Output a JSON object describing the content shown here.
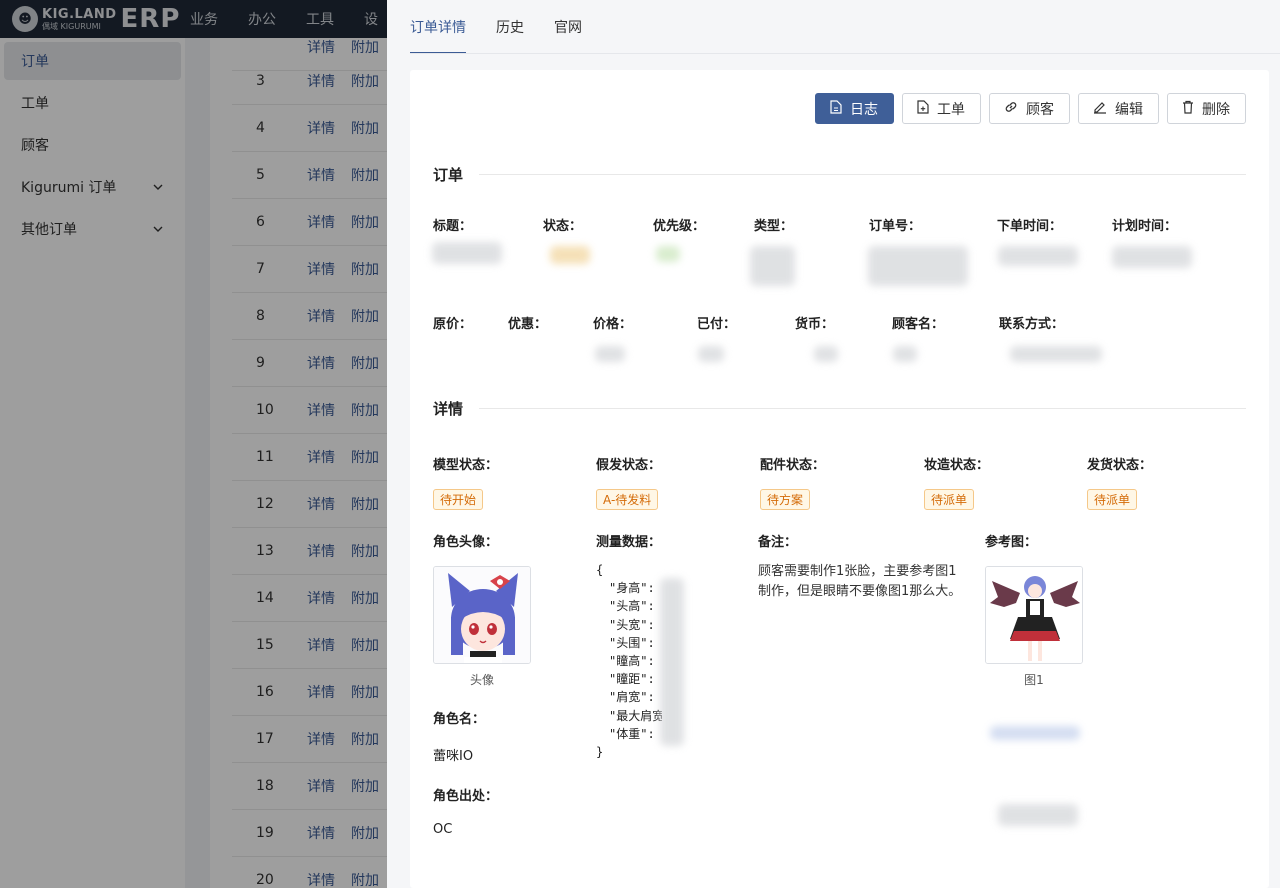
{
  "topbar": {
    "logo_main": "KIG.LAND",
    "logo_sub": "偶域 KIGURUMI",
    "logo_erp": "ERP",
    "nav": [
      "业务",
      "办公",
      "工具",
      "设"
    ]
  },
  "sidebar": {
    "items": [
      {
        "label": "订单",
        "active": true
      },
      {
        "label": "工单"
      },
      {
        "label": "顾客"
      },
      {
        "label": "Kigurumi 订单",
        "expand": true
      },
      {
        "label": "其他订单",
        "expand": true
      }
    ]
  },
  "table": {
    "link_detail": "详情",
    "link_extra": "附加",
    "rows": [
      "3",
      "4",
      "5",
      "6",
      "7",
      "8",
      "9",
      "10",
      "11",
      "12",
      "13",
      "14",
      "15",
      "16",
      "17",
      "18",
      "19",
      "20"
    ]
  },
  "drawer": {
    "tabs": [
      "订单详情",
      "历史",
      "官网"
    ],
    "toolbar": {
      "log": "日志",
      "workorder": "工单",
      "customer": "顾客",
      "edit": "编辑",
      "delete": "删除"
    },
    "order_section": "订单",
    "order_labels": [
      "标题：",
      "状态：",
      "优先级：",
      "类型：",
      "订单号：",
      "下单时间：",
      "计划时间："
    ],
    "price_labels": [
      "原价：",
      "优惠：",
      "价格：",
      "已付：",
      "货币：",
      "顾客名：",
      "联系方式："
    ],
    "detail_section": "详情",
    "status_labels": [
      "模型状态：",
      "假发状态：",
      "配件状态：",
      "妆造状态：",
      "发货状态："
    ],
    "status_tags": [
      "待开始",
      "A-待发料",
      "待方案",
      "待派单",
      "待派单"
    ],
    "avatar_label": "角色头像：",
    "avatar_caption": "头像",
    "measure_label": "测量数据：",
    "measure_open": "{",
    "measure_keys": [
      "\"身高\":",
      "\"头高\":",
      "\"头宽\":",
      "\"头围\":",
      "\"瞳高\":",
      "\"瞳距\":",
      "\"肩宽\":",
      "\"最大肩宽",
      "\"体重\":"
    ],
    "measure_close": "}",
    "note_label": "备注：",
    "note_text": "顾客需要制作1张脸，主要参考图1制作，但是眼睛不要像图1那么大。",
    "ref_label": "参考图：",
    "ref_caption": "图1",
    "role_name_label": "角色名：",
    "role_name": "蕾咪IO",
    "role_src_label": "角色出处：",
    "role_src": "OC"
  }
}
